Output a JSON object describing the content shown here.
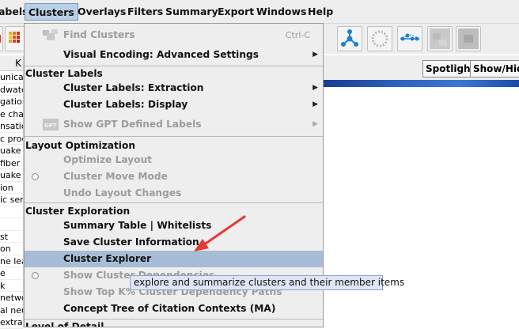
{
  "menubar": {
    "items": [
      "abels",
      "Clusters",
      "Overlays",
      "Filters",
      "Summary",
      "Export",
      "Windows",
      "Help"
    ],
    "active_index": 1
  },
  "left_panel": {
    "header": "K",
    "rows": [
      "unicat",
      "dwater",
      "gation",
      "e chan",
      "nsatio",
      "c proce",
      "uake c",
      "fiber n",
      "uake",
      "ion",
      "ic ser",
      "",
      "",
      "st",
      "on",
      "ne lea",
      "e",
      "k",
      "netwo",
      "al neur",
      "extra"
    ]
  },
  "right_toolbar": {
    "spotlight_label": "Spotlight",
    "showhide_label": "Show/Hide"
  },
  "clusters_menu": {
    "find_clusters": {
      "label": "Find Clusters",
      "shortcut": "Ctrl-C"
    },
    "visual_encoding": "Visual Encoding: Advanced Settings",
    "section_cluster_labels": "Cluster Labels",
    "labels_extraction": "Cluster Labels: Extraction",
    "labels_display": "Cluster Labels: Display",
    "show_gpt": "Show GPT Defined Labels",
    "gpt_icon_text": "GPT",
    "section_layout": "Layout Optimization",
    "optimize_layout": "Optimize Layout",
    "cluster_move_mode": "Cluster Move Mode",
    "undo_layout": "Undo Layout Changes",
    "section_exploration": "Cluster Exploration",
    "summary_table": "Summary Table | Whitelists",
    "save_cluster_info": "Save Cluster Information",
    "cluster_explorer": "Cluster Explorer",
    "show_dependencies": "Show Cluster Dependencies",
    "show_top_k": "Show Top K% Cluster Dependency Paths",
    "concept_tree": "Concept Tree of Citation Contexts (MA)",
    "section_level_of_detail": "Level of Detail"
  },
  "tooltip": {
    "text": "explore and summarize clusters and their member items"
  },
  "colors": {
    "menu_bg": "#eeeeee",
    "highlight": "#a7bcd6",
    "disabled_text": "#9c9c9c",
    "arrow_annotation": "#e53935",
    "tooltip_bg": "#dde6f4"
  },
  "icons": {
    "find_clusters": "find-clusters-icon",
    "gpt": "gpt-icon",
    "annotation": "red-arrow-annotation"
  }
}
